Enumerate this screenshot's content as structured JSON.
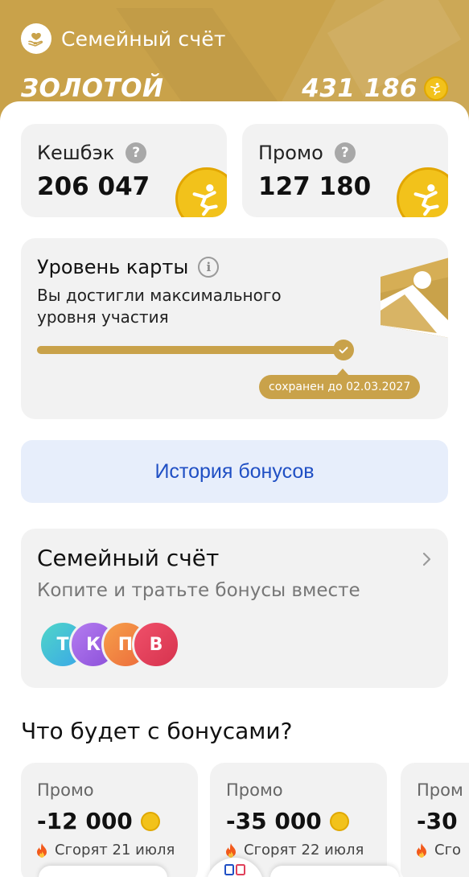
{
  "header": {
    "title": "Семейный счёт",
    "tier": "ЗОЛОТОЙ",
    "balance": "431 186",
    "color": "#c9a24a"
  },
  "cashback": {
    "label": "Кешбэк",
    "value": "206 047",
    "help": "?"
  },
  "promo_balance": {
    "label": "Промо",
    "value": "127 180",
    "help": "?"
  },
  "level": {
    "title": "Уровень карты",
    "info": "i",
    "description": "Вы достигли максимального уровня участия",
    "progress": 1.0,
    "saved_until": "сохранен до 02.03.2027"
  },
  "history_button": {
    "label": "История бонусов",
    "color": "#1f4fc4"
  },
  "family": {
    "title": "Семейный счёт",
    "subtitle": "Копите и тратьте бонусы вместе",
    "avatars": [
      {
        "letter": "Т",
        "color": "#3ec0d8"
      },
      {
        "letter": "К",
        "color": "#a260e0"
      },
      {
        "letter": "П",
        "color": "#f08a3e"
      },
      {
        "letter": "В",
        "color": "#e0405a"
      }
    ]
  },
  "bonus_future": {
    "title": "Что будет с бонусами?",
    "items": [
      {
        "label": "Промо",
        "value": "-12 000",
        "expire": "Сгорят 21 июля"
      },
      {
        "label": "Промо",
        "value": "-35 000",
        "expire": "Сгорят 22 июля"
      },
      {
        "label": "Пром",
        "value": "-30",
        "expire": "Сго"
      }
    ]
  }
}
